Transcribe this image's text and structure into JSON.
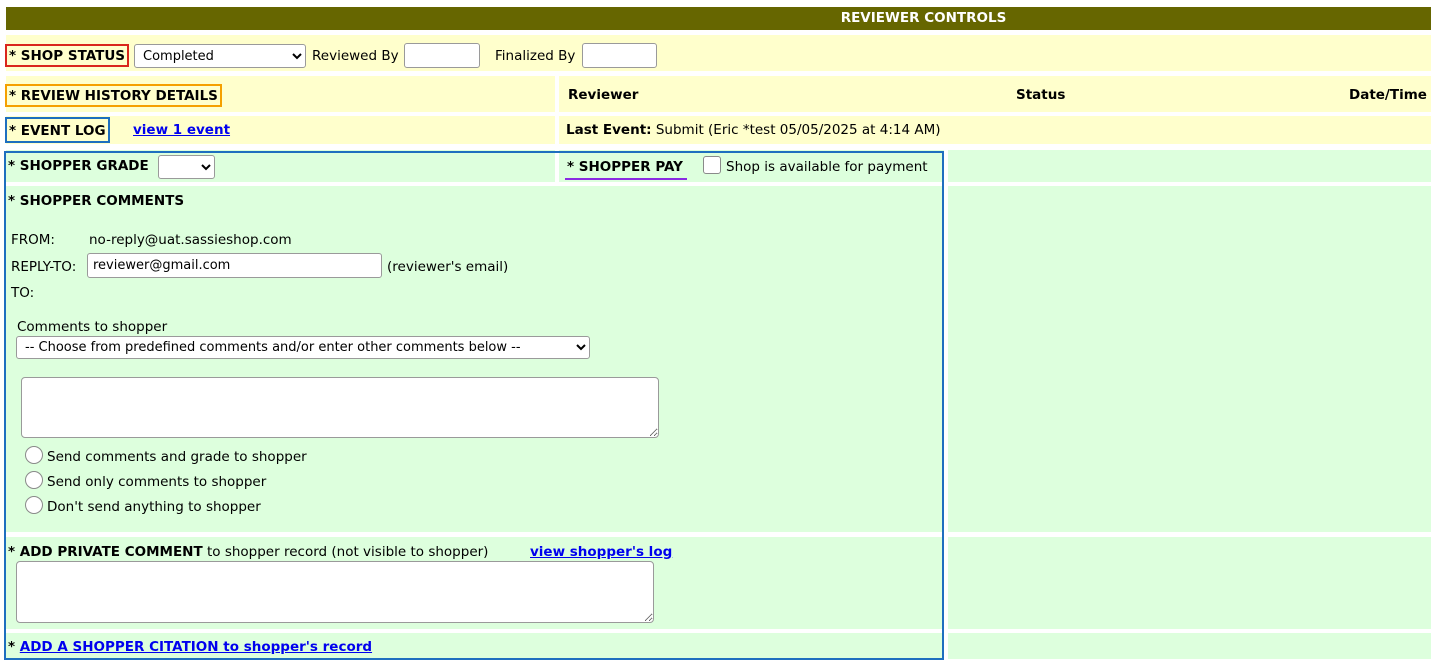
{
  "header": {
    "title": "REVIEWER CONTROLS"
  },
  "shop_status": {
    "label": "* SHOP STATUS",
    "selected": "Completed",
    "reviewed_by_label": "Reviewed By",
    "reviewed_by_value": "",
    "finalized_by_label": "Finalized By",
    "finalized_by_value": ""
  },
  "review_history": {
    "label": "* REVIEW HISTORY DETAILS",
    "col_reviewer": "Reviewer",
    "col_status": "Status",
    "col_datetime": "Date/Time"
  },
  "event_log": {
    "label": "* EVENT LOG",
    "link": "view 1 event",
    "last_event_label": "Last Event:",
    "last_event_value": "Submit (Eric *test  05/05/2025 at 4:14 AM)"
  },
  "shopper_grade": {
    "label": "* SHOPPER GRADE",
    "selected": ""
  },
  "shopper_pay": {
    "label": "* SHOPPER PAY",
    "checkbox_label": "Shop is available for payment",
    "checked": false
  },
  "comments": {
    "label": "* SHOPPER COMMENTS",
    "from_label": "FROM:",
    "from_value": "no-reply@uat.sassieshop.com",
    "reply_to_label": "REPLY-TO:",
    "reply_to_value": "reviewer@gmail.com",
    "reply_to_hint": "(reviewer's email)",
    "to_label": "TO:",
    "comments_to_shopper_label": "Comments to shopper",
    "predefined_select": "-- Choose from predefined comments and/or enter other comments below --",
    "radio_options": [
      "Send comments and grade to shopper",
      "Send only comments to shopper",
      "Don't send anything to shopper"
    ]
  },
  "private_comment": {
    "label": "* ADD PRIVATE COMMENT",
    "suffix": " to shopper record (not visible to shopper)",
    "log_link": "view shopper's log"
  },
  "citation": {
    "prefix": "* ",
    "link": "ADD A SHOPPER CITATION to shopper's record"
  },
  "colors": {
    "header_bg": "#666600",
    "yellow_row": "#ffffcc",
    "green_row": "#ddffdd",
    "shop_status_border": "#d9261c",
    "review_history_border": "#f5a000",
    "event_log_border": "#1e6fbf",
    "section_border": "#1e6fbf",
    "shopper_pay_underline": "#8a2be2"
  }
}
